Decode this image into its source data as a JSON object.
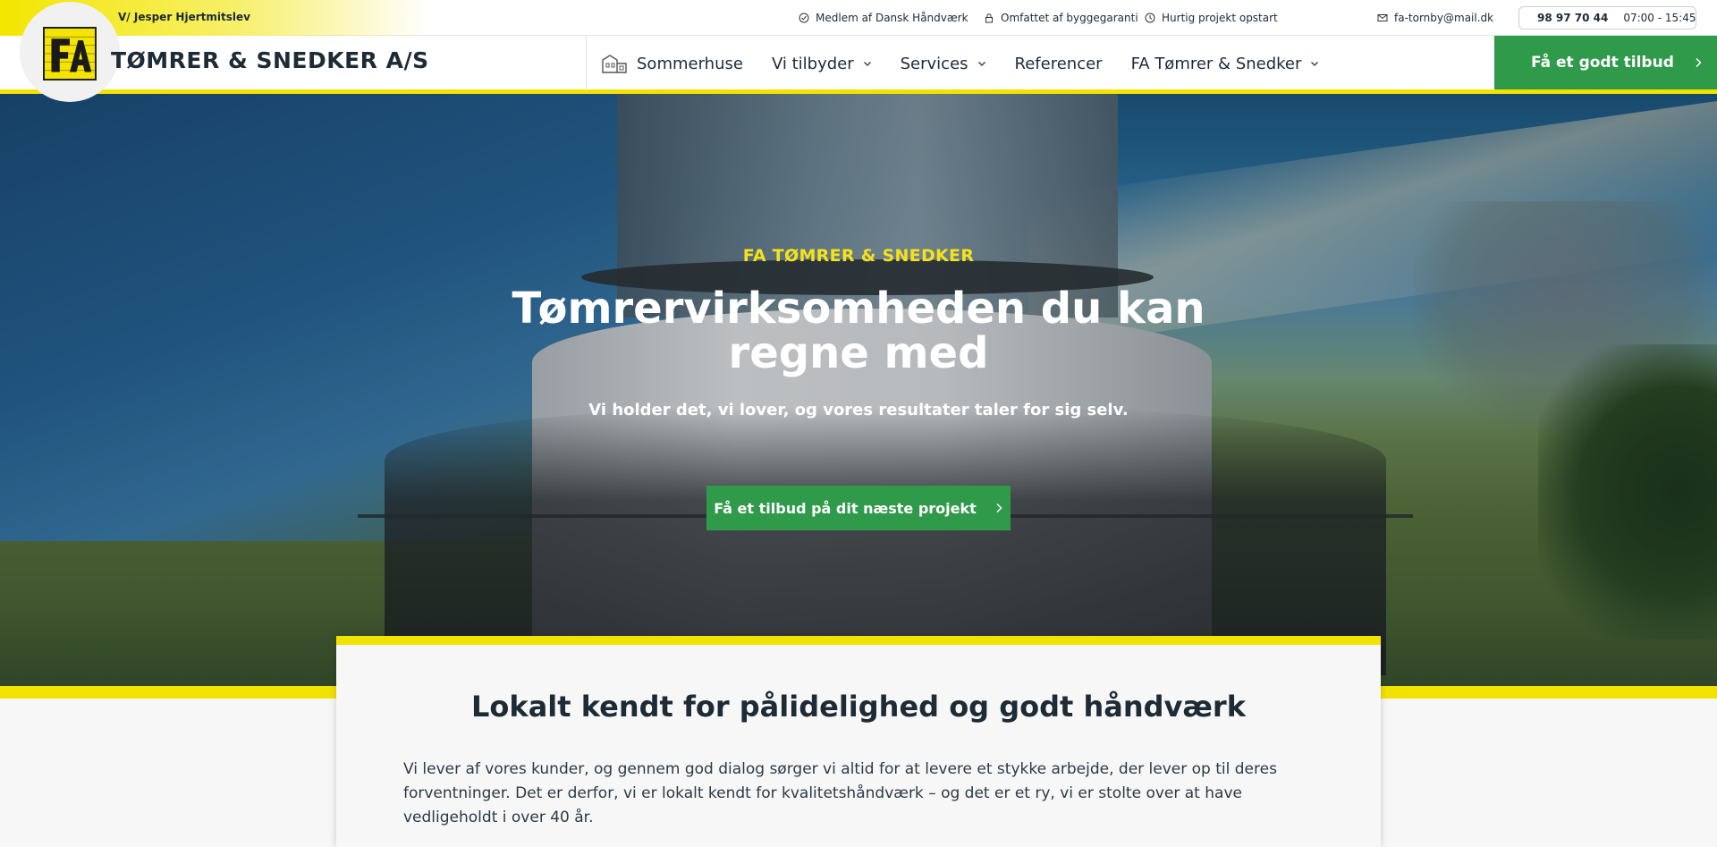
{
  "topbar": {
    "owner": "V/ Jesper Hjertmitslev",
    "usps": [
      "Medlem af Dansk Håndværk",
      "Omfattet af byggegaranti",
      "Hurtig projekt opstart"
    ],
    "email": "fa-tornby@mail.dk",
    "phone": "98 97 70 44",
    "hours": "07:00 - 15:45"
  },
  "header": {
    "brand": "TØMRER & SNEDKER A/S",
    "nav": [
      {
        "label": "Sommerhuse",
        "icon": "house-icon"
      },
      {
        "label": "Vi tilbyder",
        "dropdown": true
      },
      {
        "label": "Services",
        "dropdown": true
      },
      {
        "label": "Referencer"
      },
      {
        "label": "FA Tømrer & Snedker",
        "dropdown": true
      }
    ],
    "cta": "Få et godt tilbud"
  },
  "hero": {
    "kicker": "FA TØMRER & SNEDKER",
    "title": "Tømrervirksomheden du kan regne med",
    "subtitle": "Vi holder det, vi lover, og vores resultater taler for sig selv.",
    "cta": "Få et tilbud på dit næste projekt"
  },
  "intro": {
    "title": "Lokalt kendt for pålidelighed og godt håndværk",
    "text": "Vi lever af vores kunder, og gennem god dialog sørger vi altid for at levere et stykke arbejde, der lever op til deres forventninger. Det er derfor, vi er lokalt kendt for kvalitetshåndværk – og det er et ry, vi er stolte over at have vedligeholdt i over 40 år."
  },
  "colors": {
    "accent_yellow": "#f2e200",
    "cta_green": "#2f9a4a",
    "text_dark": "#1d2b36"
  }
}
